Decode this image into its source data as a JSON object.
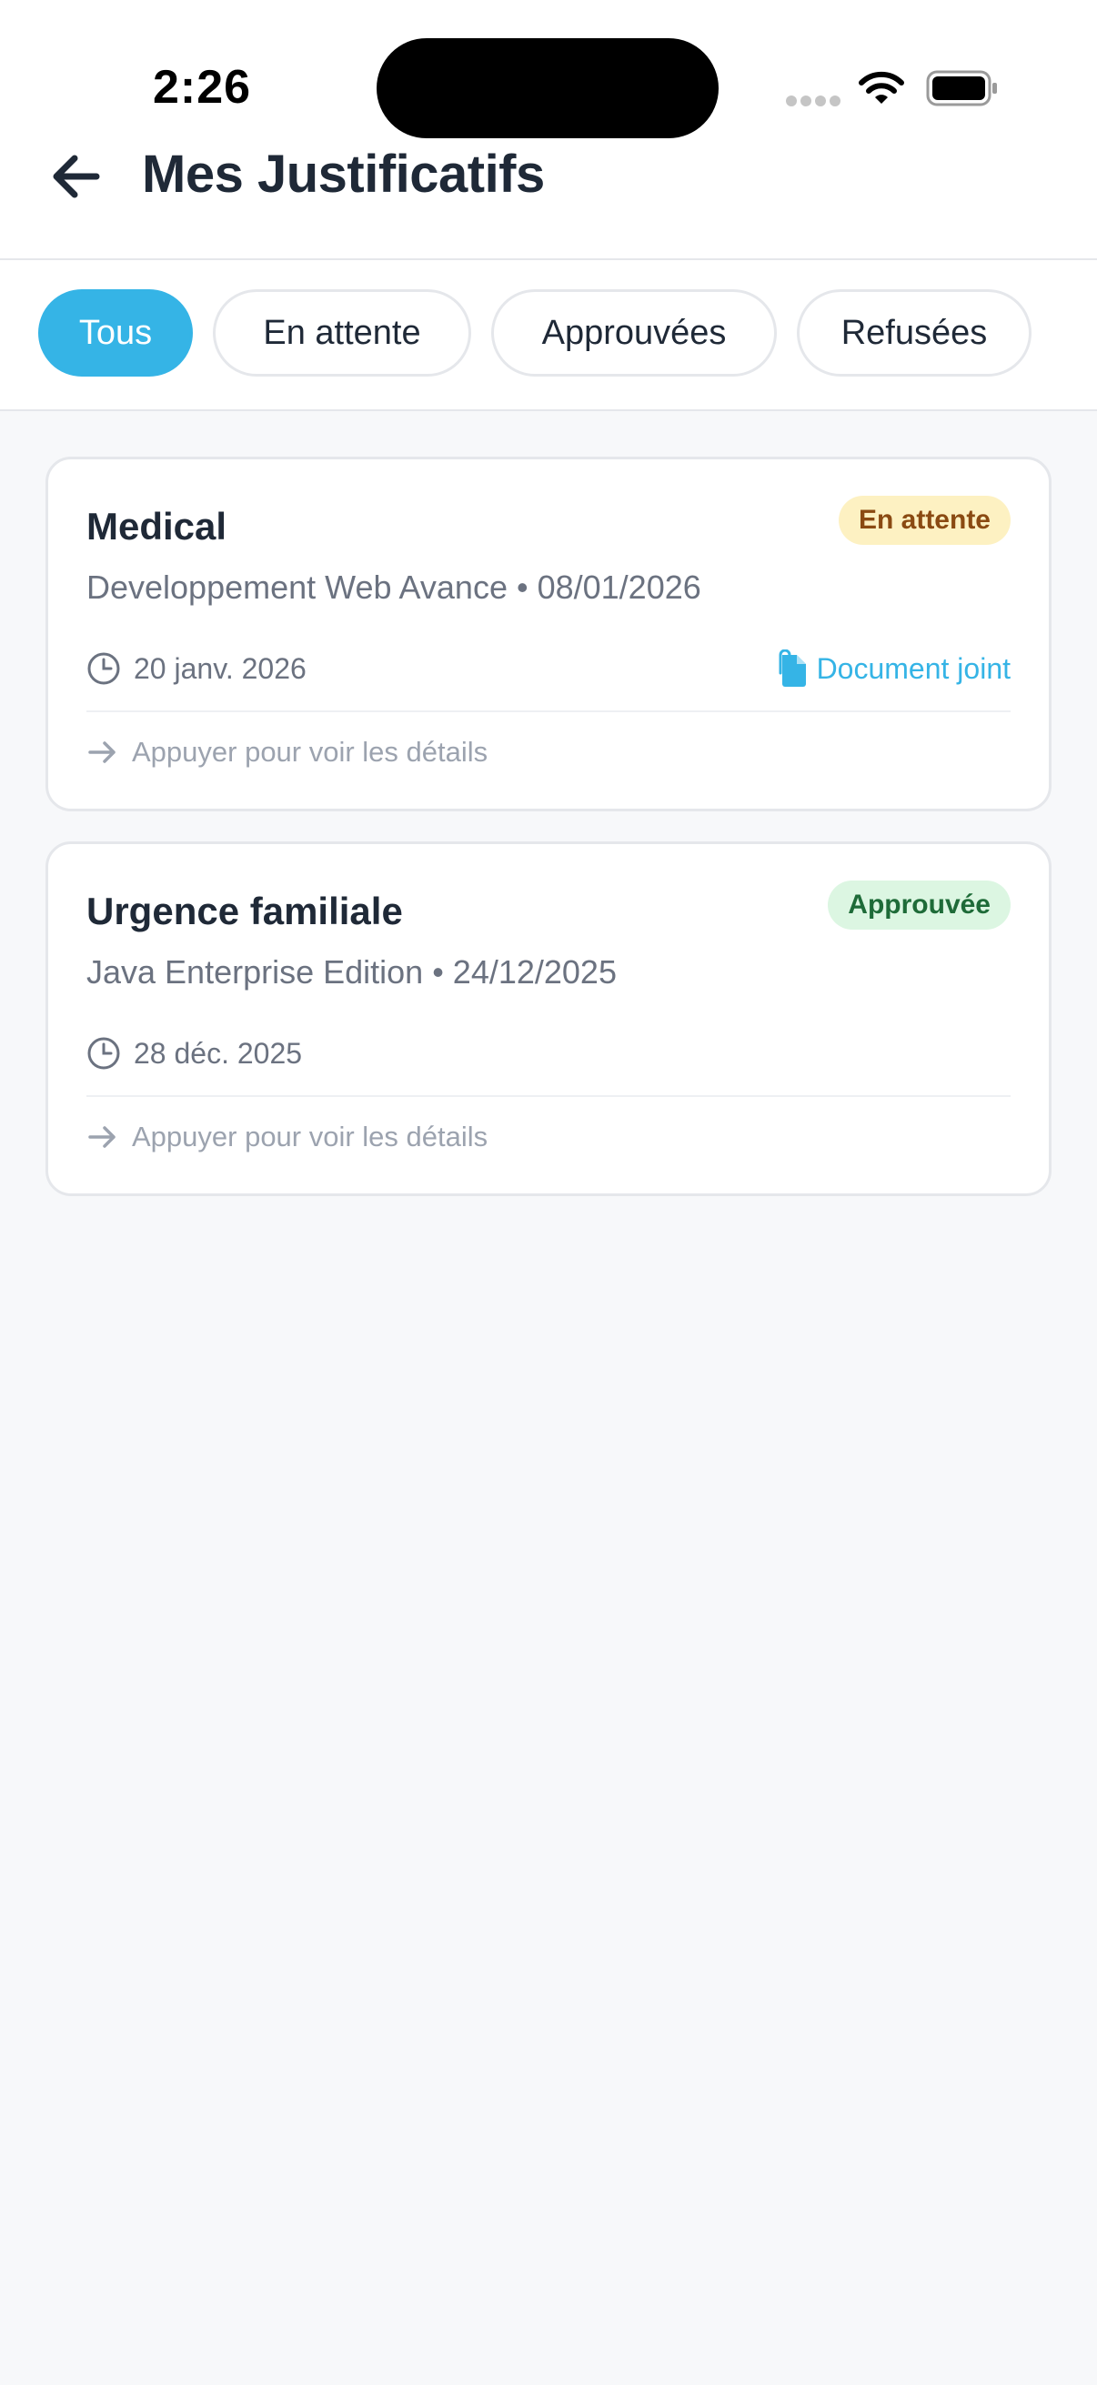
{
  "status_bar": {
    "time": "2:26"
  },
  "header": {
    "title": "Mes Justificatifs",
    "back_icon": "arrow-left-icon"
  },
  "filters": [
    {
      "label": "Tous",
      "active": true
    },
    {
      "label": "En attente",
      "active": false
    },
    {
      "label": "Approuvées",
      "active": false
    },
    {
      "label": "Refusées",
      "active": false
    }
  ],
  "cards": [
    {
      "title": "Medical",
      "status": "En attente",
      "subtitle": "Developpement Web Avance • 08/01/2026",
      "date": "20 janv. 2026",
      "document": "Document joint",
      "hint": "Appuyer pour voir les détails"
    },
    {
      "title": "Urgence familiale",
      "status": "Approuvée",
      "subtitle": "Java Enterprise Edition • 24/12/2025",
      "date": "28 déc. 2025",
      "hint": "Appuyer pour voir les détails"
    }
  ],
  "colors": {
    "accent": "#35b4e6",
    "pending_bg": "#fdf1c2",
    "pending_text": "#8a4a12",
    "approved_bg": "#dcf6e2",
    "approved_text": "#1e6b38"
  }
}
